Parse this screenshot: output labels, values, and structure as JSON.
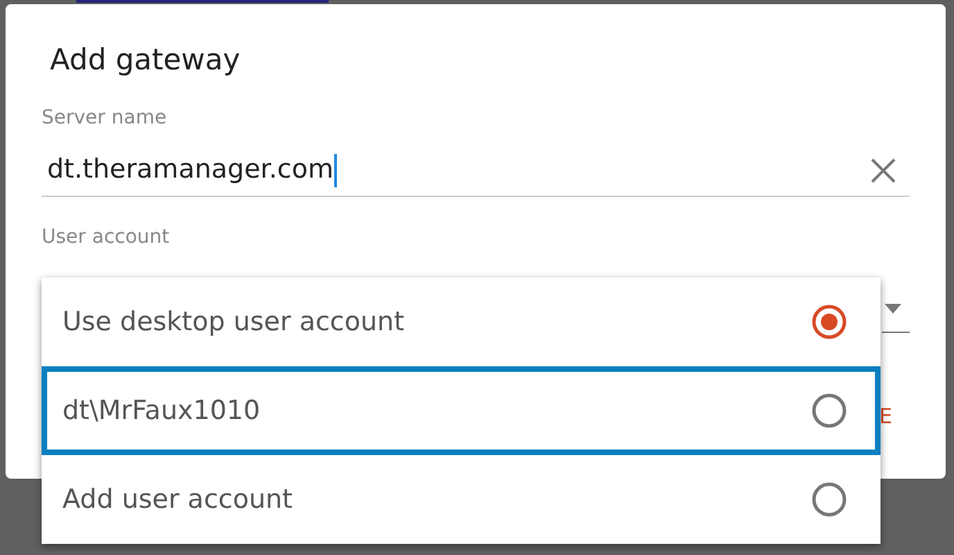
{
  "dialog": {
    "title": "Add gateway",
    "server_name": {
      "label": "Server name",
      "value": "dt.theramanager.com",
      "focused": true
    },
    "user_account": {
      "label": "User account"
    },
    "action_button": {
      "label": "E"
    }
  },
  "menu": {
    "items": [
      {
        "label": "Use desktop user account",
        "selected": true,
        "focused": false
      },
      {
        "label": "dt\\MrFaux1010",
        "selected": false,
        "focused": true
      },
      {
        "label": "Add user account",
        "selected": false,
        "focused": false
      }
    ]
  }
}
